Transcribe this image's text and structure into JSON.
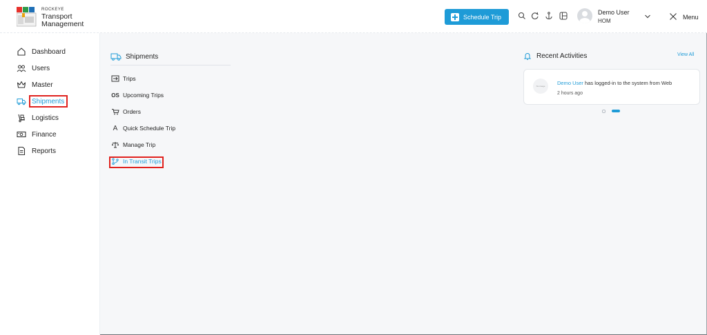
{
  "brand": {
    "company": "ROCKEYE",
    "line1": "Transport",
    "line2": "Management"
  },
  "header": {
    "schedule_button": "Schedule Trip",
    "icons": [
      "search-icon",
      "refresh-icon",
      "anchor-icon",
      "grid-icon"
    ],
    "user": {
      "name": "Demo User",
      "role": "HOM"
    },
    "menu_label": "Menu"
  },
  "sidebar": {
    "items": [
      {
        "label": "Dashboard",
        "icon": "home-icon"
      },
      {
        "label": "Users",
        "icon": "users-icon"
      },
      {
        "label": "Master",
        "icon": "crown-icon"
      },
      {
        "label": "Shipments",
        "icon": "truck-icon",
        "active": true
      },
      {
        "label": "Logistics",
        "icon": "dolly-icon"
      },
      {
        "label": "Finance",
        "icon": "money-icon"
      },
      {
        "label": "Reports",
        "icon": "document-icon"
      }
    ]
  },
  "shipments": {
    "title": "Shipments",
    "items": [
      {
        "label": "Trips",
        "icon": "trips-icon"
      },
      {
        "label": "Upcoming Trips",
        "icon": "os-icon",
        "glyph": "OS"
      },
      {
        "label": "Orders",
        "icon": "cart-icon"
      },
      {
        "label": "Quick Schedule Trip",
        "icon": "quick-schedule-icon",
        "glyph": "A"
      },
      {
        "label": "Manage Trip",
        "icon": "scale-icon"
      },
      {
        "label": "In Transit Trips",
        "icon": "branch-icon",
        "active": true
      }
    ]
  },
  "recent": {
    "title": "Recent Activities",
    "view_all": "View All",
    "activity": {
      "user": "Demo User",
      "text": " has logged-in to the system from Web",
      "time": "2 hours ago",
      "avatar_text": "No image"
    }
  },
  "colors": {
    "accent": "#1e9bd7",
    "highlight": "#e0211d"
  }
}
